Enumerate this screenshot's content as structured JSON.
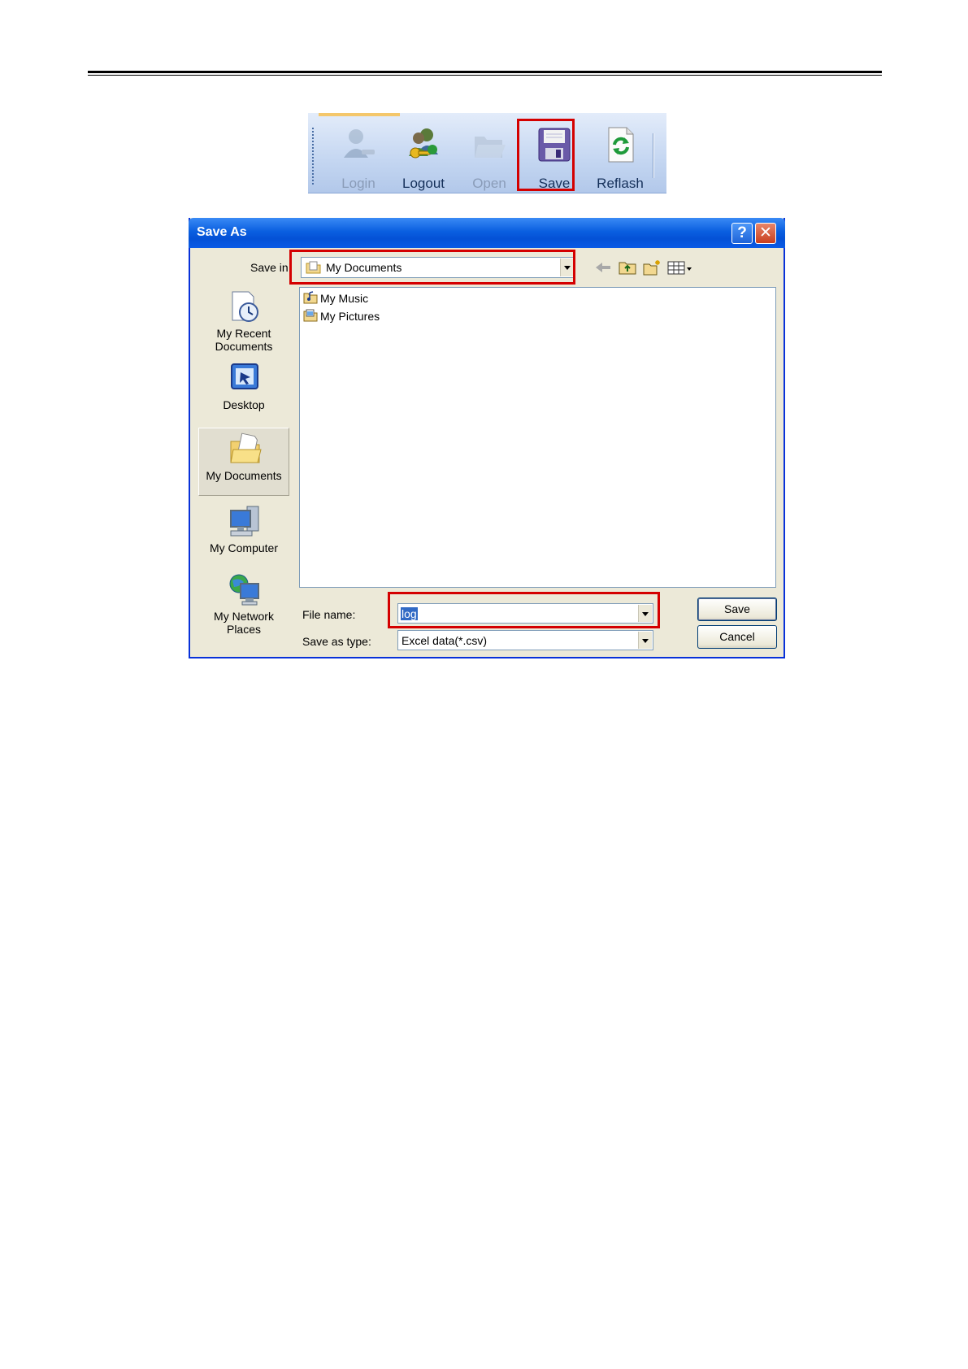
{
  "toolbar": {
    "buttons": [
      {
        "label": "Login",
        "icon": "login-icon",
        "enabled": false
      },
      {
        "label": "Logout",
        "icon": "logout-icon",
        "enabled": true
      },
      {
        "label": "Open",
        "icon": "open-folder-icon",
        "enabled": false
      },
      {
        "label": "Save",
        "icon": "floppy-disk-icon",
        "enabled": true
      },
      {
        "label": "Reflash",
        "icon": "refresh-icon",
        "enabled": true
      }
    ]
  },
  "dialog": {
    "title": "Save As",
    "help_glyph": "?",
    "close_glyph": "✕",
    "save_in_label": "Save in:",
    "save_in_value": "My Documents",
    "places": [
      {
        "label_line1": "My Recent",
        "label_line2": "Documents",
        "icon": "recent-documents-icon"
      },
      {
        "label_line1": "Desktop",
        "label_line2": "",
        "icon": "desktop-icon"
      },
      {
        "label_line1": "My Documents",
        "label_line2": "",
        "icon": "my-documents-icon",
        "selected": true
      },
      {
        "label_line1": "My Computer",
        "label_line2": "",
        "icon": "my-computer-icon"
      },
      {
        "label_line1": "My Network",
        "label_line2": "Places",
        "icon": "network-places-icon"
      }
    ],
    "files": [
      "My Music",
      "My Pictures"
    ],
    "file_name_label": "File name:",
    "file_name_value": "log",
    "save_as_type_label": "Save as type:",
    "save_as_type_value": "Excel data(*.csv)",
    "save_button": "Save",
    "cancel_button": "Cancel"
  },
  "colors": {
    "highlight": "#d40000",
    "title_bar": "#0a5fe0",
    "dialog_bg": "#ece9d8"
  }
}
